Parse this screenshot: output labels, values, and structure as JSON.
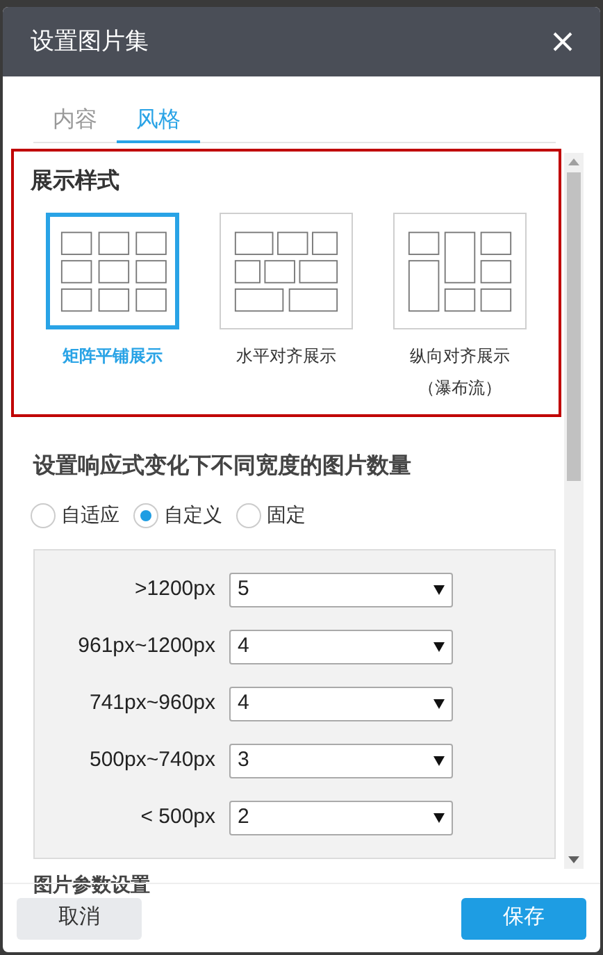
{
  "window": {
    "title": "设置图片集"
  },
  "tabs": [
    {
      "label": "内容",
      "selected": false
    },
    {
      "label": "风格",
      "selected": true
    }
  ],
  "display_style": {
    "heading": "展示样式",
    "options": [
      {
        "kind": "grid",
        "label": "矩阵平铺展示",
        "selected": true
      },
      {
        "kind": "horizontal",
        "label": "水平对齐展示",
        "selected": false
      },
      {
        "kind": "vertical",
        "label": "纵向对齐展示",
        "sublabel": "（瀑布流）",
        "selected": false
      }
    ]
  },
  "responsive": {
    "heading": "设置响应式变化下不同宽度的图片数量",
    "modes": [
      {
        "label": "自适应",
        "selected": false
      },
      {
        "label": "自定义",
        "selected": true
      },
      {
        "label": "固定",
        "selected": false
      }
    ],
    "rows": [
      {
        "label": ">1200px",
        "value": "5"
      },
      {
        "label": "961px~1200px",
        "value": "4"
      },
      {
        "label": "741px~960px",
        "value": "4"
      },
      {
        "label": "500px~740px",
        "value": "3"
      },
      {
        "label": "< 500px",
        "value": "2"
      }
    ]
  },
  "next_section": {
    "heading": "图片参数设置"
  },
  "buttons": [
    {
      "kind": "cancel",
      "label": "取消"
    },
    {
      "kind": "save",
      "label": "保存"
    }
  ]
}
